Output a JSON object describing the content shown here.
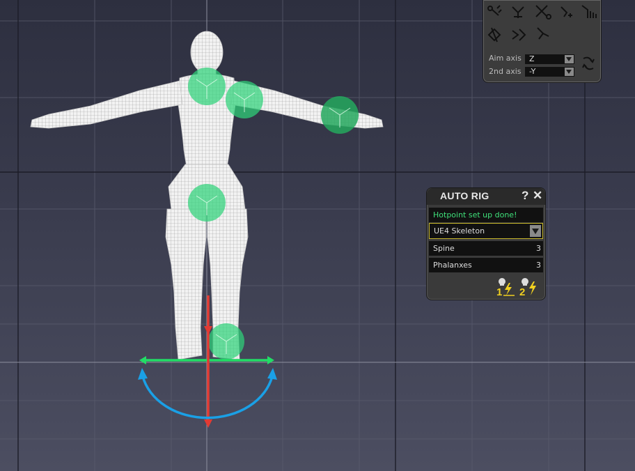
{
  "tool_panel": {
    "aim_axis_label": "Aim axis",
    "aim_axis_value": "Z",
    "second_axis_label": "2nd axis",
    "second_axis_value": "-Y",
    "tool_icons": [
      "bone-create-icon",
      "bone-connect-icon",
      "bone-remove-icon",
      "bone-insert-icon",
      "bone-chain-icon",
      "bone-mirror-icon",
      "bone-split-icon",
      "bone-align-icon"
    ],
    "swap_icon": "axis-swap-icon"
  },
  "auto_rig": {
    "title": "AUTO RIG",
    "help_glyph": "?",
    "close_glyph": "✕",
    "status": "Hotpoint set up done!",
    "skeleton_selected": "UE4 Skeleton",
    "spine_label": "Spine",
    "spine_value": "3",
    "phalanxes_label": "Phalanxes",
    "phalanxes_value": "3",
    "rig_step1_label": "1",
    "rig_step2_label": "2"
  },
  "colors": {
    "hotpoint_green": "#2fd27a",
    "gizmo_red": "#e23a33",
    "gizmo_green": "#22dd66",
    "gizmo_blue": "#1aa0e6",
    "status_text": "#3fe07a",
    "icon_yellow": "#f0d020"
  }
}
